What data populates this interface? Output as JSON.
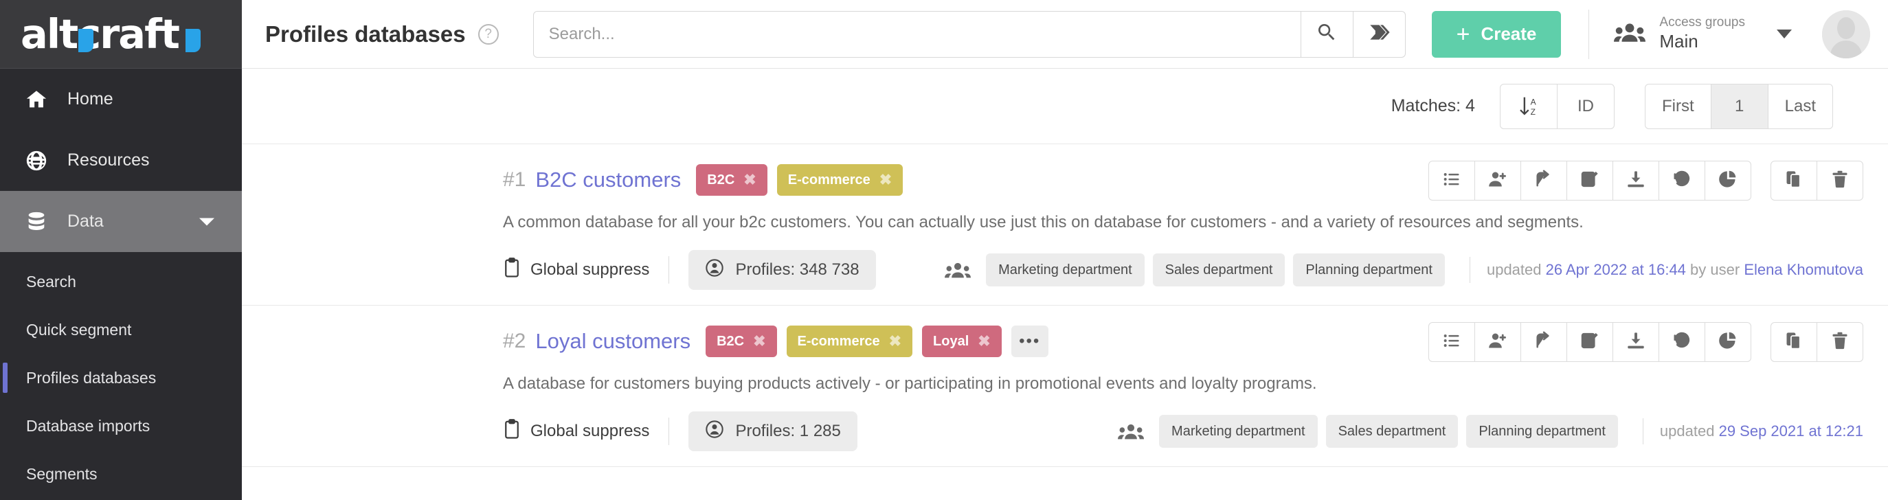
{
  "brand": {
    "name": "altcraft",
    "accent": "#29a3e8"
  },
  "sidebar": {
    "nav": [
      {
        "label": "Home",
        "icon": "home-icon"
      },
      {
        "label": "Resources",
        "icon": "globe-icon"
      },
      {
        "label": "Data",
        "icon": "database-icon"
      }
    ],
    "subnav": [
      {
        "label": "Search"
      },
      {
        "label": "Quick segment"
      },
      {
        "label": "Profiles databases"
      },
      {
        "label": "Database imports"
      },
      {
        "label": "Segments"
      }
    ],
    "active_nav": "Data",
    "active_sub": "Profiles databases",
    "active_indicator_color": "#6f73d2"
  },
  "topbar": {
    "title": "Profiles databases",
    "help_icon": "?",
    "search_placeholder": "Search...",
    "search_value": "",
    "search_button_icon": "search-icon",
    "tag_button_icon": "tag-icon",
    "create_label": "Create",
    "create_color": "#5fcfaa",
    "access_label": "Access groups",
    "access_value": "Main"
  },
  "toolbar": {
    "matches_label": "Matches: 4",
    "sort_icon": "sort-az-icon",
    "sort_field": "ID",
    "pagination": {
      "first": "First",
      "page": "1",
      "last": "Last"
    }
  },
  "actions": {
    "group1": [
      "list-icon",
      "add-user-icon",
      "share-icon",
      "edit-icon",
      "download-icon",
      "history-icon",
      "pie-chart-icon"
    ],
    "group2": [
      "copy-icon",
      "trash-icon"
    ]
  },
  "records": [
    {
      "num": "#1",
      "title": "B2C customers",
      "tags": [
        {
          "label": "B2C",
          "color": "red"
        },
        {
          "label": "E-commerce",
          "color": "olive"
        }
      ],
      "overflow": null,
      "description": "A common database for all your b2c customers. You can actually use just this on database for customers - and a variety of resources and segments.",
      "global_suppress": "Global suppress",
      "profiles": "Profiles: 348 738",
      "departments": [
        "Marketing department",
        "Sales department",
        "Planning department"
      ],
      "updated_prefix": "updated",
      "updated_date": "26 Apr 2022 at 16:44",
      "updated_by_label": "by user",
      "updated_user": "Elena Khomutova"
    },
    {
      "num": "#2",
      "title": "Loyal customers",
      "tags": [
        {
          "label": "B2C",
          "color": "red"
        },
        {
          "label": "E-commerce",
          "color": "olive"
        },
        {
          "label": "Loyal",
          "color": "red"
        }
      ],
      "overflow": "•••",
      "description": "A database for customers buying products actively - or participating in promotional events and loyalty programs.",
      "global_suppress": "Global suppress",
      "profiles": "Profiles: 1 285",
      "departments": [
        "Marketing department",
        "Sales department",
        "Planning department"
      ],
      "updated_prefix": "updated",
      "updated_date": "29 Sep 2021 at 12:21",
      "updated_by_label": "",
      "updated_user": ""
    }
  ],
  "colors": {
    "tag_red": "#cf6a7e",
    "tag_olive": "#cfc057",
    "link": "#6f73d2",
    "sidebar": "#2b2b2f"
  }
}
